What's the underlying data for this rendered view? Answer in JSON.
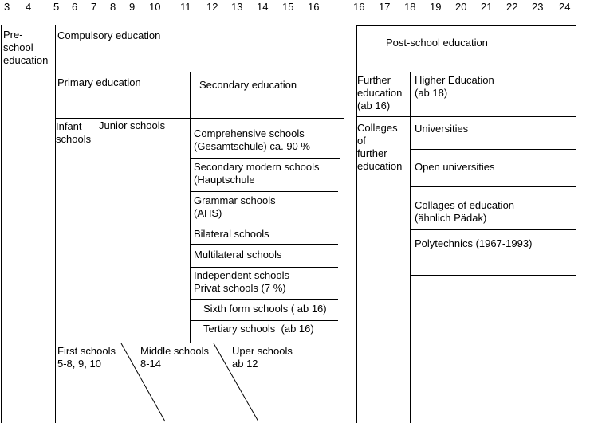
{
  "age_axis": {
    "school_ages": [
      "3",
      "4",
      "5",
      "6",
      "7",
      "8",
      "9",
      "10",
      "11",
      "12",
      "13",
      "14",
      "15",
      "16"
    ],
    "post_school_ages": [
      "16",
      "17",
      "18",
      "19",
      "20",
      "21",
      "22",
      "23",
      "24"
    ]
  },
  "school_section": {
    "preschool": "Pre-\nschool\neducation",
    "compulsory": "Compulsory education",
    "primary": "Primary education",
    "secondary": "Secondary education",
    "infant": "Infant\nschools",
    "junior": "Junior schools",
    "secondary_types": [
      "Comprehensive schools\n(Gesamtschule) ca. 90 %",
      "Secondary modern schools\n(Hauptschule",
      "Grammar schools\n(AHS)",
      "Bilateral schools",
      "Multilateral schools",
      "Independent schools\nPrivat schools (7 %)",
      "Sixth form schools ( ab 16)",
      "Tertiary schools  (ab 16)"
    ],
    "three_tier": [
      "First schools\n5-8, 9, 10",
      "Middle schools\n8-14",
      "Uper schools\nab 12"
    ]
  },
  "post_school_section": {
    "title": "Post-school education",
    "further": "Further\neducation\n(ab 16)",
    "higher": "Higher Education\n(ab 18)",
    "colleges_further": "Colleges\nof\nfurther\neducation",
    "higher_types": [
      "Universities",
      "Open universities",
      "Collages of education\n(ähnlich Pädak)",
      "Polytechnics (1967-1993)"
    ]
  }
}
